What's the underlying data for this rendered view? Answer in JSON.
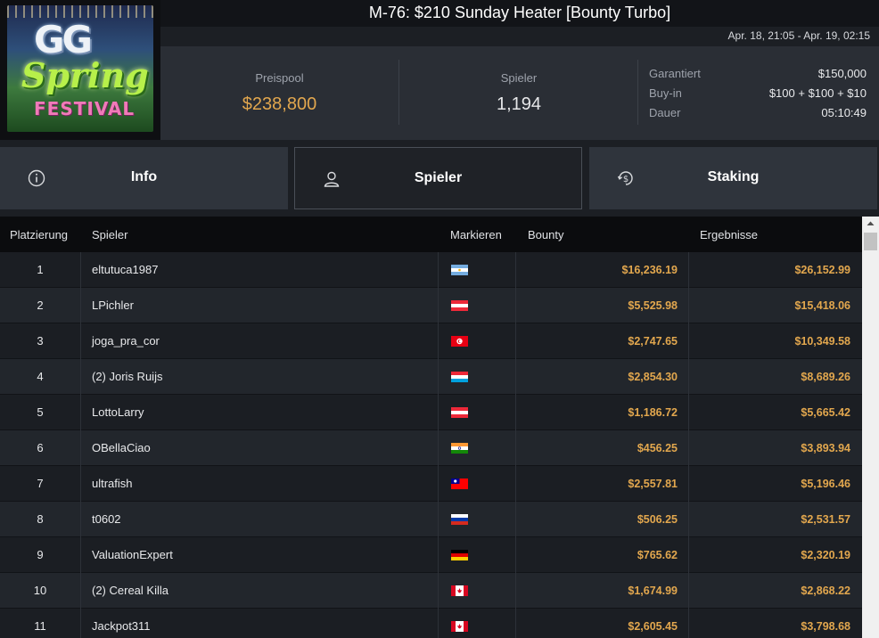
{
  "header": {
    "title": "M-76: $210 Sunday Heater [Bounty Turbo]",
    "date_range": "Apr. 18, 21:05 - Apr. 19, 02:15",
    "logo": {
      "line1": "GG",
      "line2": "Spring",
      "line3": "FESTIVAL"
    }
  },
  "stats": {
    "prize_pool_label": "Preispool",
    "prize_pool_value": "$238,800",
    "players_label": "Spieler",
    "players_value": "1,194",
    "details": [
      {
        "key": "Garantiert",
        "value": "$150,000"
      },
      {
        "key": "Buy-in",
        "value": "$100 + $100 + $10"
      },
      {
        "key": "Dauer",
        "value": "05:10:49"
      }
    ]
  },
  "tabs": [
    {
      "label": "Info",
      "icon": "info-icon",
      "active": false
    },
    {
      "label": "Spieler",
      "icon": "user-icon",
      "active": true
    },
    {
      "label": "Staking",
      "icon": "dollar-cycle-icon",
      "active": false
    }
  ],
  "table": {
    "columns": {
      "place": "Platzierung",
      "player": "Spieler",
      "flag": "Markieren",
      "bounty": "Bounty",
      "result": "Ergebnisse"
    },
    "rows": [
      {
        "place": "1",
        "name": "eltutuca1987",
        "country": "argentina",
        "bounty": "$16,236.19",
        "result": "$26,152.99"
      },
      {
        "place": "2",
        "name": "LPichler",
        "country": "austria",
        "bounty": "$5,525.98",
        "result": "$15,418.06"
      },
      {
        "place": "3",
        "name": "joga_pra_cor",
        "country": "tunisia",
        "bounty": "$2,747.65",
        "result": "$10,349.58"
      },
      {
        "place": "4",
        "name": "(2) Joris Ruijs",
        "country": "luxembourg",
        "bounty": "$2,854.30",
        "result": "$8,689.26"
      },
      {
        "place": "5",
        "name": "LottoLarry",
        "country": "austria",
        "bounty": "$1,186.72",
        "result": "$5,665.42"
      },
      {
        "place": "6",
        "name": "OBellaCiao",
        "country": "india",
        "bounty": "$456.25",
        "result": "$3,893.94"
      },
      {
        "place": "7",
        "name": "ultrafish",
        "country": "taiwan",
        "bounty": "$2,557.81",
        "result": "$5,196.46"
      },
      {
        "place": "8",
        "name": "t0602",
        "country": "russia",
        "bounty": "$506.25",
        "result": "$2,531.57"
      },
      {
        "place": "9",
        "name": "ValuationExpert",
        "country": "germany",
        "bounty": "$765.62",
        "result": "$2,320.19"
      },
      {
        "place": "10",
        "name": "(2) Cereal Killa",
        "country": "canada",
        "bounty": "$1,674.99",
        "result": "$2,868.22"
      },
      {
        "place": "11",
        "name": "Jackpot311",
        "country": "canada",
        "bounty": "$2,605.45",
        "result": "$3,798.68"
      }
    ]
  },
  "colors": {
    "accent_gold": "#e2a74e",
    "bg_dark": "#15181c",
    "panel": "#2a2e35"
  }
}
